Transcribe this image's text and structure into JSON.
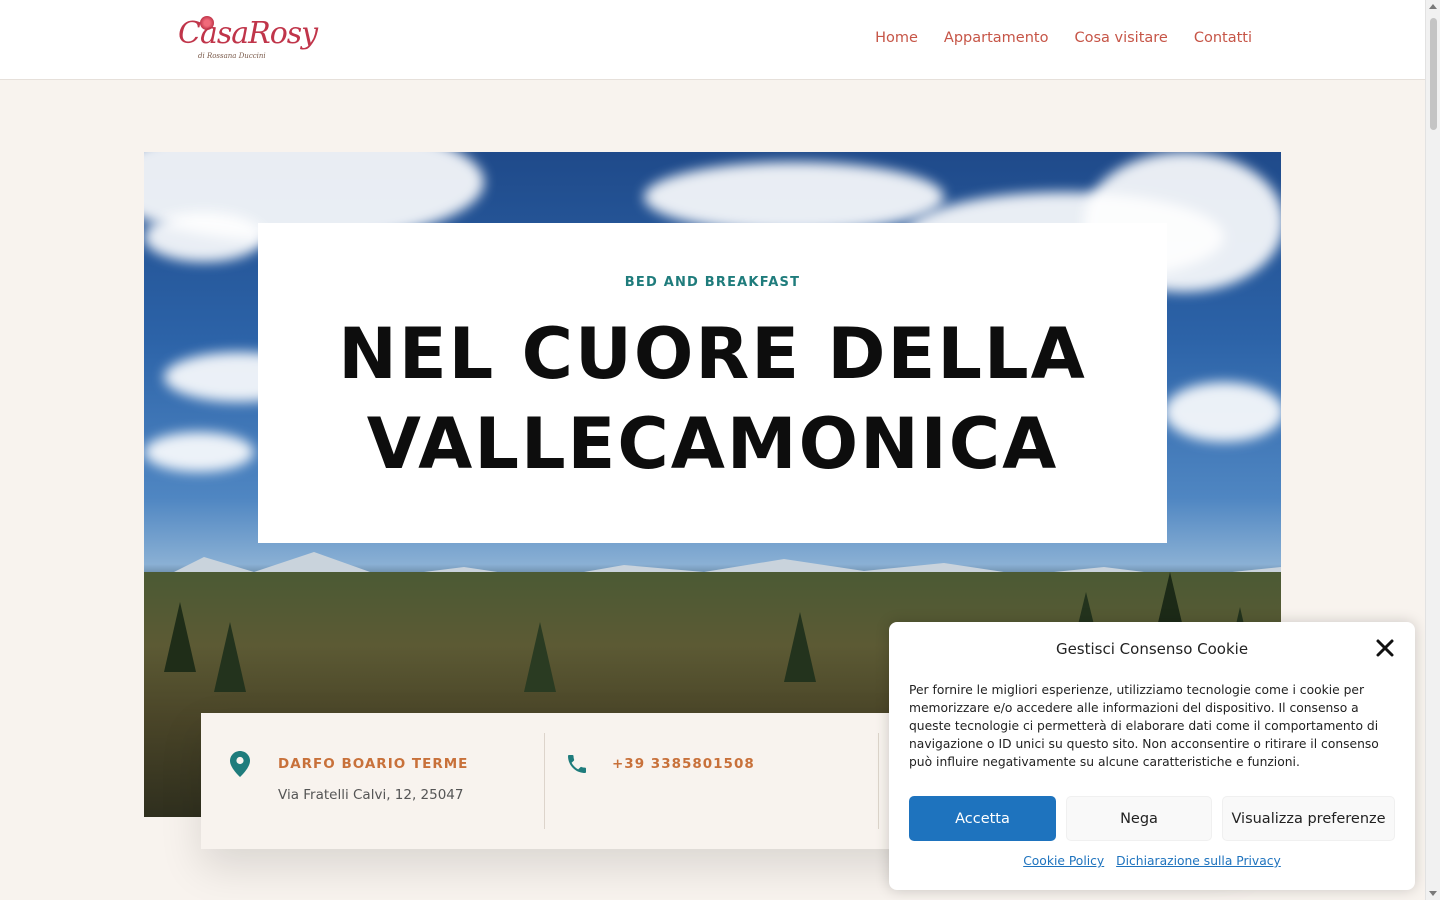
{
  "header": {
    "logo_text": "CasaRosy",
    "logo_subtitle": "di Rossana Duccini",
    "nav": [
      "Home",
      "Appartamento",
      "Cosa visitare",
      "Contatti"
    ]
  },
  "hero": {
    "eyebrow": "BED AND BREAKFAST",
    "title_line1": "NEL CUORE DELLA",
    "title_line2": "VALLECAMONICA"
  },
  "info": {
    "location_title": "DARFO BOARIO TERME",
    "location_address": "Via Fratelli Calvi, 12, 25047",
    "phone_number": "+39 3385801508",
    "icons": [
      "map-pin-icon",
      "phone-icon"
    ]
  },
  "cookie": {
    "title": "Gestisci Consenso Cookie",
    "body": "Per fornire le migliori esperienze, utilizziamo tecnologie come i cookie per memorizzare e/o accedere alle informazioni del dispositivo. Il consenso a queste tecnologie ci permetterà di elaborare dati come il comportamento di navigazione o ID unici su questo sito. Non acconsentire o ritirare il consenso può influire negativamente su alcune caratteristiche e funzioni.",
    "accept_label": "Accetta",
    "deny_label": "Nega",
    "prefs_label": "Visualizza preferenze",
    "cookie_policy_link": "Cookie Policy",
    "privacy_link": "Dichiarazione sulla Privacy"
  },
  "colors": {
    "accent_teal": "#1f7c7c",
    "accent_orange": "#c8713a",
    "nav_red": "#c65547",
    "button_blue": "#1e73be",
    "page_bg": "#f8f3ee"
  }
}
